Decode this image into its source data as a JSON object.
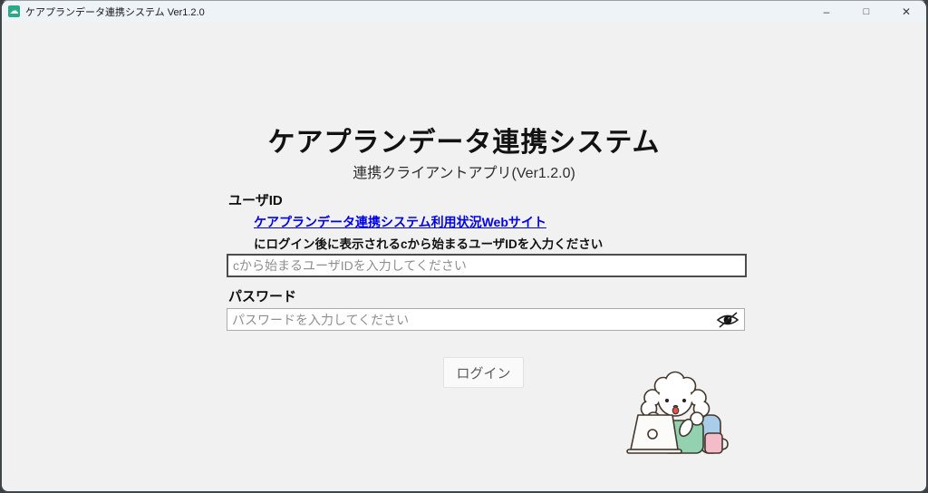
{
  "window": {
    "title": "ケアプランデータ連携システム Ver1.2.0",
    "app_icon": "cloud-sync-app-icon",
    "app_icon_glyph": "☁",
    "app_icon_color": "#2aa98b",
    "controls": {
      "minimize": "–",
      "maximize": "□",
      "close": "✕"
    }
  },
  "main": {
    "heading": "ケアプランデータ連携システム",
    "subheading": "連携クライアントアプリ(Ver1.2.0)",
    "user_id": {
      "label": "ユーザID",
      "link_text": "ケアプランデータ連携システム利用状況Webサイト",
      "instruction": "にログイン後に表示されるcから始まるユーザIDを入力ください",
      "placeholder": "cから始まるユーザIDを入力してください",
      "value": ""
    },
    "password": {
      "label": "パスワード",
      "placeholder": "パスワードを入力してください",
      "value": "",
      "toggle_icon": "eye-slash-icon"
    },
    "login_button_label": "ログイン",
    "illustration": "poodle-at-laptop-illustration"
  },
  "colors": {
    "titlebar_bg": "#eef3f8",
    "content_bg": "#f1f1f2",
    "link": "#0000e8",
    "frame": "#41464b"
  }
}
